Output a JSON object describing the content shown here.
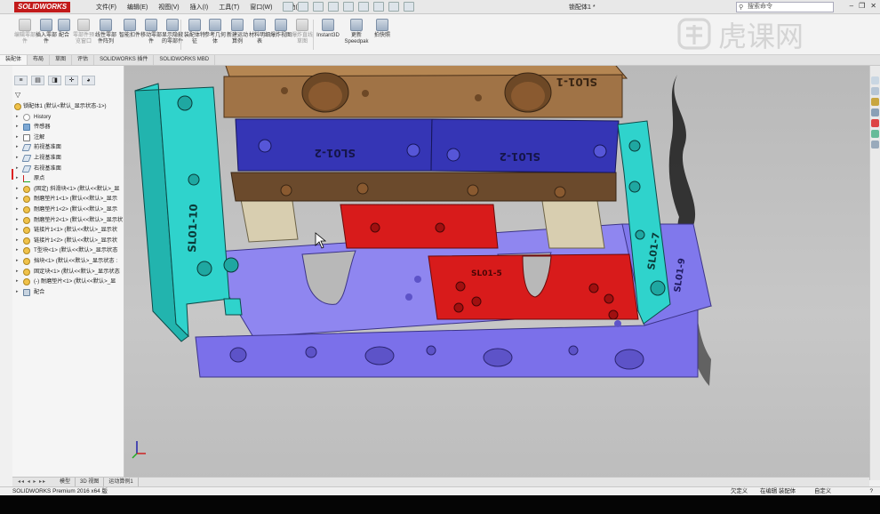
{
  "app": {
    "logo_text": "SOLIDWORKS",
    "document_title": "锁配体1 *",
    "search_placeholder": "搜索命令",
    "watermark": "虎课网"
  },
  "menus": [
    "文件(F)",
    "编辑(E)",
    "视图(V)",
    "插入(I)",
    "工具(T)",
    "窗口(W)",
    "帮助(H)"
  ],
  "ribbon": {
    "buttons": [
      {
        "label": "编辑零部件",
        "enabled": false
      },
      {
        "label": "插入零部件",
        "enabled": true
      },
      {
        "label": "配合",
        "enabled": true
      },
      {
        "label": "零部件预览窗口",
        "enabled": false
      },
      {
        "label": "线性零部件阵列",
        "enabled": true
      },
      {
        "label": "智能扣件",
        "enabled": true
      },
      {
        "label": "移动零部件",
        "enabled": true
      },
      {
        "label": "显示隐藏的零部件",
        "enabled": true
      },
      {
        "label": "装配体特征",
        "enabled": true
      },
      {
        "label": "参考几何体",
        "enabled": true
      },
      {
        "label": "新建运动算例",
        "enabled": true
      },
      {
        "label": "材料明细表",
        "enabled": true
      },
      {
        "label": "爆炸视图",
        "enabled": true
      },
      {
        "label": "爆炸直线草图",
        "enabled": false
      },
      {
        "label": "Instant3D",
        "enabled": true
      },
      {
        "label": "更新Speedpak",
        "enabled": true
      },
      {
        "label": "拍快照",
        "enabled": true
      }
    ]
  },
  "command_tabs": [
    "装配体",
    "布局",
    "草图",
    "评估",
    "SOLIDWORKS 插件",
    "SOLIDWORKS MBD"
  ],
  "tree": {
    "filter_icon": "filter-icon",
    "root": "锁配体1 (默认<默认_显示状态-1>)",
    "items": [
      {
        "label": "History",
        "icon": "history"
      },
      {
        "label": "传感器",
        "icon": "folder"
      },
      {
        "label": "注解",
        "icon": "note"
      },
      {
        "label": "前视基准面",
        "icon": "plane"
      },
      {
        "label": "上视基准面",
        "icon": "plane"
      },
      {
        "label": "右视基准面",
        "icon": "plane"
      },
      {
        "label": "原点",
        "icon": "origin"
      },
      {
        "label": "(固定) 斜滑块<1> (默认<<默认>_显",
        "icon": "part"
      },
      {
        "label": "耐磨垫片1<1> (默认<<默认>_显示",
        "icon": "part"
      },
      {
        "label": "耐磨垫片1<2> (默认<<默认>_显示",
        "icon": "part"
      },
      {
        "label": "耐磨垫片2<1> (默认<<默认>_显示状",
        "icon": "part"
      },
      {
        "label": "链接片1<1> (默认<<默认>_显示状",
        "icon": "part"
      },
      {
        "label": "链接片1<2> (默认<<默认>_显示状",
        "icon": "part"
      },
      {
        "label": "T型块<1> (默认<<默认>_显示状态",
        "icon": "part"
      },
      {
        "label": "挡块<1> (默认<<默认>_显示状态 :",
        "icon": "part"
      },
      {
        "label": "固定块<1> (默认<<默认>_显示状态",
        "icon": "part"
      },
      {
        "label": "(-) 耐磨垫片<1> (默认<<默认>_显",
        "icon": "part"
      },
      {
        "label": "配合",
        "icon": "mate"
      }
    ]
  },
  "model": {
    "labels": {
      "top_block": "SL01-1",
      "blue_left": "SL01-2",
      "blue_right": "SL01-2",
      "cyan_left": "SL01-10",
      "cyan_right": "SL01-7",
      "purple_right": "SL01-9",
      "red_plate": "SL01-5"
    },
    "colors": {
      "brown": "#a07346",
      "blue": "#3535b5",
      "cyan": "#2fd3cc",
      "red": "#d81b1b",
      "purple": "#7b70ea",
      "beige": "#d8ceb0"
    }
  },
  "bottom_tabs": [
    "模型",
    "3D 视图",
    "运动算例1"
  ],
  "status": {
    "product": "SOLIDWORKS Premium 2016 x64 版",
    "s1": "欠定义",
    "s2": "在编辑 装配体",
    "s3": "自定义",
    "help": "?"
  }
}
